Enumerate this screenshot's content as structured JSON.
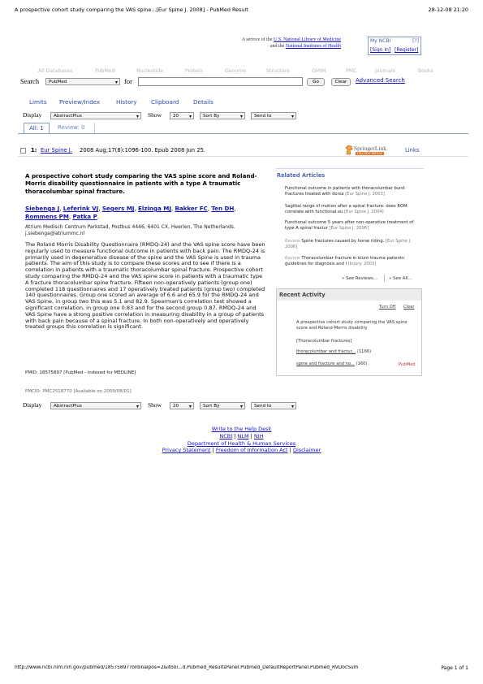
{
  "print_header": {
    "title": "A prospective cohort study comparing the VAS spine...[Eur Spine J. 2008] - PubMed Result",
    "datetime": "28-12-08 21:20"
  },
  "banner": {
    "service_text": "A service of the",
    "nlm": "U.S. National Library of Medicine",
    "and_text": "and the",
    "nih": "National Institutes of Health"
  },
  "myncbi": {
    "title": "My NCBI",
    "help": "[?]",
    "signin": "[Sign In]",
    "register": "[Register]"
  },
  "db_tabs": [
    "All Databases",
    "PubMed",
    "Nucleotide",
    "Protein",
    "Genome",
    "Structure",
    "OMIM",
    "PMC",
    "Journals",
    "Books"
  ],
  "search": {
    "label": "Search",
    "db": "PubMed",
    "for": "for",
    "go": "Go",
    "clear": "Clear",
    "advanced": "Advanced Search"
  },
  "nav_tabs": [
    "Limits",
    "Preview/Index",
    "History",
    "Clipboard",
    "Details"
  ],
  "display": {
    "label": "Display",
    "format": "AbstractPlus",
    "show": "Show",
    "count": "20",
    "sort": "Sort By",
    "send": "Send to"
  },
  "result_tabs": {
    "all": "All: 1",
    "review": "Review: 0"
  },
  "citation": {
    "num": "1:",
    "journal": "Eur Spine J.",
    "details": "2008 Aug;17(8):1096-100. Epub 2008 Jun 25.",
    "publisher": "SpringerLink",
    "publisher_sub": "FULL-TEXT ARTICLE",
    "links": "Links"
  },
  "article": {
    "title": "A prospective cohort study comparing the VAS spine score and Roland-Morris disability questionnaire in patients with a type A traumatic thoracolumbar spinal fracture.",
    "authors": [
      "Siebenga J",
      "Leferink VJ",
      "Segers MJ",
      "Elzinga MJ",
      "Bakker FC",
      "Ten DH",
      "Rommens PM",
      "Patka P"
    ],
    "affiliation": "Atrium Medisch Centrum Parkstad, Postbus 4446, 6401 CX, Heerlen, The Netherlands. j.siebenga@atriummc.nl",
    "abstract": "The Roland Morris Disability Questionnaire (RMDQ-24) and the VAS spine score have been regularly used to measure functional outcome in patients with back pain. The RMDQ-24 is primarily used in degenerative disease of the spine and the VAS Spine is used in trauma patients. The aim of this study is to compare these scores and to see if there is a correlation in patients with a traumatic thoracolumbar spinal fracture. Prospective cohort study comparing the RMDQ-24 and the VAS spine score in patients with a traumatic type A fracture thoracolumbar spine fracture. Fifteen non-operatively patients (group one) completed 118 questionnaires and 17 operatively treated patients (group two) completed 140 questionnaires. Group one scored an average of 6.6 and 65.9 for the RMDQ-24 and VAS Spine, in group two this was 5.1 and 82.9. Spearman's correlation test showed a significant correlation, in group one 0.83 and for the second group 0.87. RMDQ-24 and VAS Spine have a strong positive correlation in measuring disability in a group of patients with back pain because of a spinal fracture. In both non-operatively and operatively treated groups this correlation is significant.",
    "pmid": "PMID: 18575897 [PubMed - indexed for MEDLINE]",
    "pmcid": "PMCID: PMC2518770 [Available on 2009/08/01]"
  },
  "related": {
    "title": "Related Articles",
    "items": [
      {
        "text": "Functional outcome in patients with thoracolumbar burst fractures treated with dorsa",
        "journal": "[Eur Spine J. 2003]",
        "review": ""
      },
      {
        "text": "Sagittal range of motion after a spinal fracture: does ROM correlate with functional ou",
        "journal": "[Eur Spine J. 2004]",
        "review": ""
      },
      {
        "text": "Functional outcome 5 years after non-operative treatment of type A spinal fractur",
        "journal": "[Eur Spine J. 2006]",
        "review": ""
      },
      {
        "text": "Spine fractures caused by horse riding.",
        "journal": "[Eur Spine J. 2006]",
        "review": "Review"
      },
      {
        "text": "Thoracolumbar fracture in blunt trauma patients: guidelines for diagnosis and i",
        "journal": "[Injury. 2003]",
        "review": "Review"
      }
    ],
    "see_reviews": "» See Reviews...",
    "see_all": "» See All..."
  },
  "recent": {
    "title": "Recent Activity",
    "turn_off": "Turn Off",
    "clear": "Clear",
    "entry": "A prospective cohort study comparing the VAS spine score and Roland-Morris disability",
    "query1": "[Thoracolumbar fractures]",
    "query2": "thoracolumbar and fractur...",
    "count2": "(1166)",
    "query3": "spine and fracture and no...",
    "count3": "(160)",
    "db": "PubMed"
  },
  "footer": {
    "help": "Write to the Help Desk",
    "ncbi": "NCBI",
    "nlm": "NLM",
    "nih": "NIH",
    "dhhs": "Department of Health & Human Services",
    "privacy": "Privacy Statement",
    "foi": "Freedom of Information Act",
    "disclaimer": "Disclaimer"
  },
  "print_footer": {
    "url": "http://www.ncbi.nlm.nih.gov/pubmed/18575897?ordinalpos=2&itool...d.Pubmed_ResultsPanel.Pubmed_DefaultReportPanel.Pubmed_RVDocSum",
    "page": "Page 1 of 1"
  }
}
